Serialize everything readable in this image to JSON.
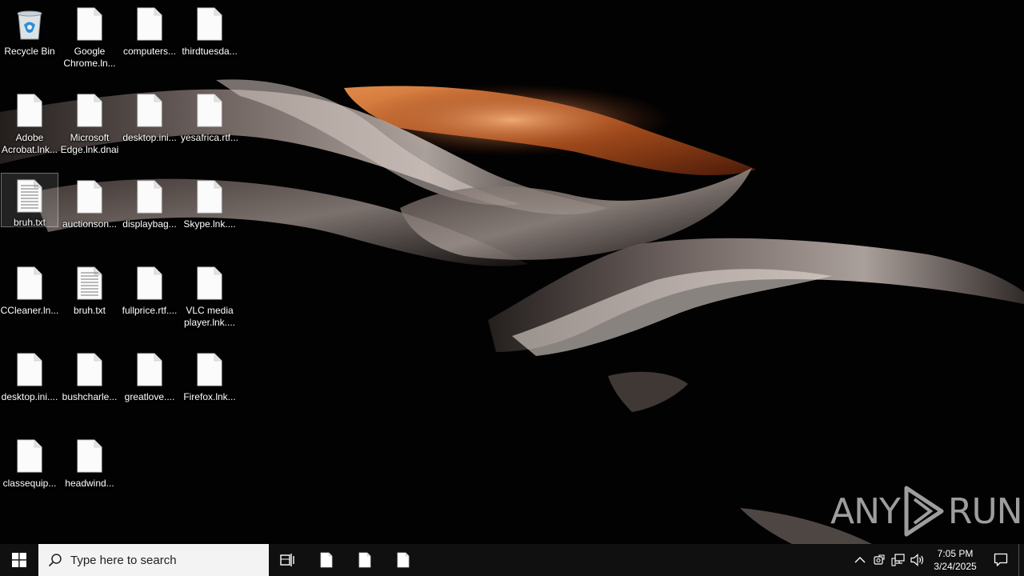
{
  "desktop": {
    "icons": [
      {
        "label": "Recycle Bin",
        "kind": "recycle-bin"
      },
      {
        "label": "Google\nChrome.ln...",
        "kind": "file"
      },
      {
        "label": "computers...",
        "kind": "file"
      },
      {
        "label": "thirdtuesda...",
        "kind": "file"
      },
      {
        "label": "Adobe\nAcrobat.lnk...",
        "kind": "file"
      },
      {
        "label": "Microsoft\nEdge.lnk.dnai",
        "kind": "file"
      },
      {
        "label": "desktop.ini...",
        "kind": "file"
      },
      {
        "label": "yesafrica.rtf...",
        "kind": "file"
      },
      {
        "label": "bruh.txt",
        "kind": "text-file",
        "selected": true
      },
      {
        "label": "auctionson...",
        "kind": "file"
      },
      {
        "label": "displaybag...",
        "kind": "file"
      },
      {
        "label": "Skype.lnk....",
        "kind": "file"
      },
      {
        "label": "CCleaner.ln...",
        "kind": "file"
      },
      {
        "label": "bruh.txt",
        "kind": "text-file"
      },
      {
        "label": "fullprice.rtf....",
        "kind": "file"
      },
      {
        "label": "VLC media\nplayer.lnk....",
        "kind": "file"
      },
      {
        "label": "desktop.ini....",
        "kind": "file"
      },
      {
        "label": "bushcharle...",
        "kind": "file"
      },
      {
        "label": "greatlove....",
        "kind": "file"
      },
      {
        "label": "Firefox.lnk...",
        "kind": "file"
      },
      {
        "label": "classequip...",
        "kind": "file"
      },
      {
        "label": "headwind...",
        "kind": "file"
      }
    ]
  },
  "watermark": {
    "left": "ANY",
    "right": "RUN"
  },
  "taskbar": {
    "start_icon": "windows-logo-icon",
    "search_placeholder": "Type here to search",
    "task_view_icon": "task-view-icon",
    "pinned_apps": [
      "file-icon",
      "file-icon",
      "file-icon"
    ],
    "tray_icons": [
      "chevron-up-icon",
      "meet-now-icon",
      "network-icon",
      "volume-icon"
    ],
    "clock_time": "7:05 PM",
    "clock_date": "3/24/2025",
    "notification_icon": "action-center-icon"
  },
  "colors": {
    "taskbar_bg": "#101010",
    "search_bg": "#f3f3f3",
    "wallpaper_warm": "#b5551f",
    "label_text": "#ffffff"
  }
}
